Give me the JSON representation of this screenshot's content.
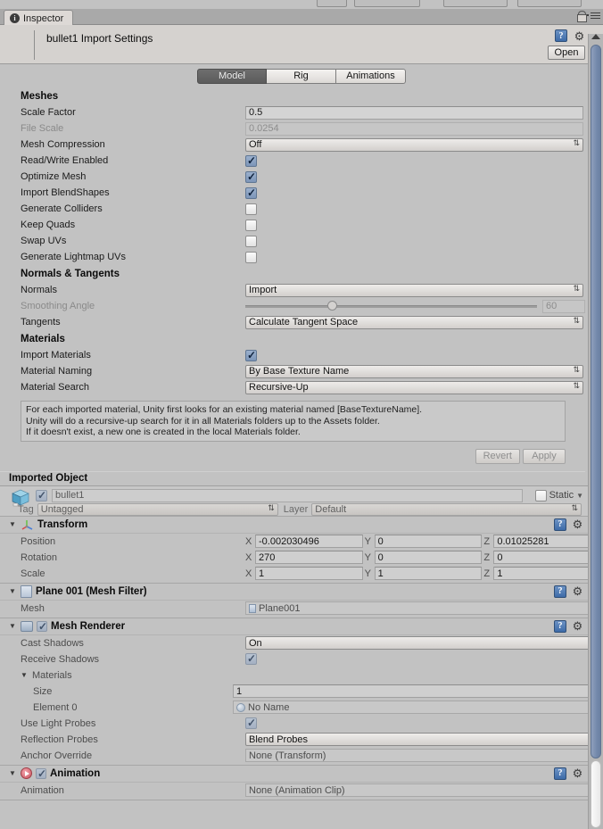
{
  "window": {
    "tab_label": "Inspector",
    "tab_icon": "info-icon",
    "lock_icon": "lock-icon",
    "menu_icon": "hamburger-menu-icon"
  },
  "asset_header": {
    "title": "bullet1 Import Settings",
    "help_icon": "help-book-icon",
    "gear_icon": "gear-icon",
    "open_label": "Open"
  },
  "mode_tabs": [
    {
      "label": "Model",
      "active": true
    },
    {
      "label": "Rig",
      "active": false
    },
    {
      "label": "Animations",
      "active": false
    }
  ],
  "meshes": {
    "section_title": "Meshes",
    "scale_factor": {
      "label": "Scale Factor",
      "value": "0.5"
    },
    "file_scale": {
      "label": "File Scale",
      "value": "0.0254"
    },
    "mesh_compression": {
      "label": "Mesh Compression",
      "value": "Off"
    },
    "read_write_enabled": {
      "label": "Read/Write Enabled",
      "checked": true
    },
    "optimize_mesh": {
      "label": "Optimize Mesh",
      "checked": true
    },
    "import_blendshapes": {
      "label": "Import BlendShapes",
      "checked": true
    },
    "generate_colliders": {
      "label": "Generate Colliders",
      "checked": false
    },
    "keep_quads": {
      "label": "Keep Quads",
      "checked": false
    },
    "swap_uvs": {
      "label": "Swap UVs",
      "checked": false
    },
    "generate_lightmap_uvs": {
      "label": "Generate Lightmap UVs",
      "checked": false
    }
  },
  "normals": {
    "section_title": "Normals & Tangents",
    "normals": {
      "label": "Normals",
      "value": "Import"
    },
    "smoothing_angle": {
      "label": "Smoothing Angle",
      "value": "60",
      "handle_pct": 28
    },
    "tangents": {
      "label": "Tangents",
      "value": "Calculate Tangent Space"
    }
  },
  "materials": {
    "section_title": "Materials",
    "import_materials": {
      "label": "Import Materials",
      "checked": true
    },
    "material_naming": {
      "label": "Material Naming",
      "value": "By Base Texture Name"
    },
    "material_search": {
      "label": "Material Search",
      "value": "Recursive-Up"
    },
    "help_line_1": "For each imported material, Unity first looks for an existing material named [BaseTextureName].",
    "help_line_2": "Unity will do a recursive-up search for it in all Materials folders up to the Assets folder.",
    "help_line_3": "If it doesn't exist, a new one is created in the local Materials folder.",
    "revert_label": "Revert",
    "apply_label": "Apply"
  },
  "imported_object": {
    "section_title": "Imported Object",
    "prefab_icon": "prefab-cube-icon",
    "enabled": true,
    "name": "bullet1",
    "static_label": "Static",
    "static_checked": false,
    "tag_label": "Tag",
    "tag_value": "Untagged",
    "layer_label": "Layer",
    "layer_value": "Default"
  },
  "components": [
    {
      "name": "Transform",
      "icon": "transform-axis-icon",
      "expanded": true,
      "has_checkbox": false,
      "rows": [
        {
          "type": "vector3",
          "label": "Position",
          "x": "-0.002030496",
          "y": "0",
          "z": "0.01025281"
        },
        {
          "type": "vector3",
          "label": "Rotation",
          "x": "270",
          "y": "0",
          "z": "0"
        },
        {
          "type": "vector3",
          "label": "Scale",
          "x": "1",
          "y": "1",
          "z": "1"
        }
      ]
    },
    {
      "name": "Plane 001 (Mesh Filter)",
      "icon": "mesh-filter-icon",
      "expanded": true,
      "has_checkbox": false,
      "rows": [
        {
          "type": "object",
          "label": "Mesh",
          "value": "Plane001",
          "obj_icon": "mesh-icon"
        }
      ]
    },
    {
      "name": "Mesh Renderer",
      "icon": "mesh-renderer-icon",
      "expanded": true,
      "has_checkbox": true,
      "checked": true,
      "rows": [
        {
          "type": "dropdown",
          "label": "Cast Shadows",
          "value": "On"
        },
        {
          "type": "checkbox",
          "label": "Receive Shadows",
          "checked": true
        },
        {
          "type": "foldout",
          "label": "Materials"
        },
        {
          "type": "field",
          "label": "Size",
          "value": "1",
          "sub": true
        },
        {
          "type": "object",
          "label": "Element 0",
          "value": "No Name",
          "obj_icon": "material-icon",
          "sub": true
        },
        {
          "type": "checkbox",
          "label": "Use Light Probes",
          "checked": true
        },
        {
          "type": "dropdown",
          "label": "Reflection Probes",
          "value": "Blend Probes"
        },
        {
          "type": "object",
          "label": "Anchor Override",
          "value": "None (Transform)"
        }
      ]
    },
    {
      "name": "Animation",
      "icon": "animation-icon",
      "expanded": true,
      "has_checkbox": true,
      "checked": true,
      "rows": [
        {
          "type": "object",
          "label": "Animation",
          "value": "None (Animation Clip)"
        }
      ]
    }
  ],
  "colors": {
    "window_bg": "#c2c2c2",
    "header_bg": "#d5d2cf",
    "accent_checkbox": "#7c95b8",
    "scrollbar_thumb": "#7489ab",
    "active_tab": "#5c5c5c"
  }
}
